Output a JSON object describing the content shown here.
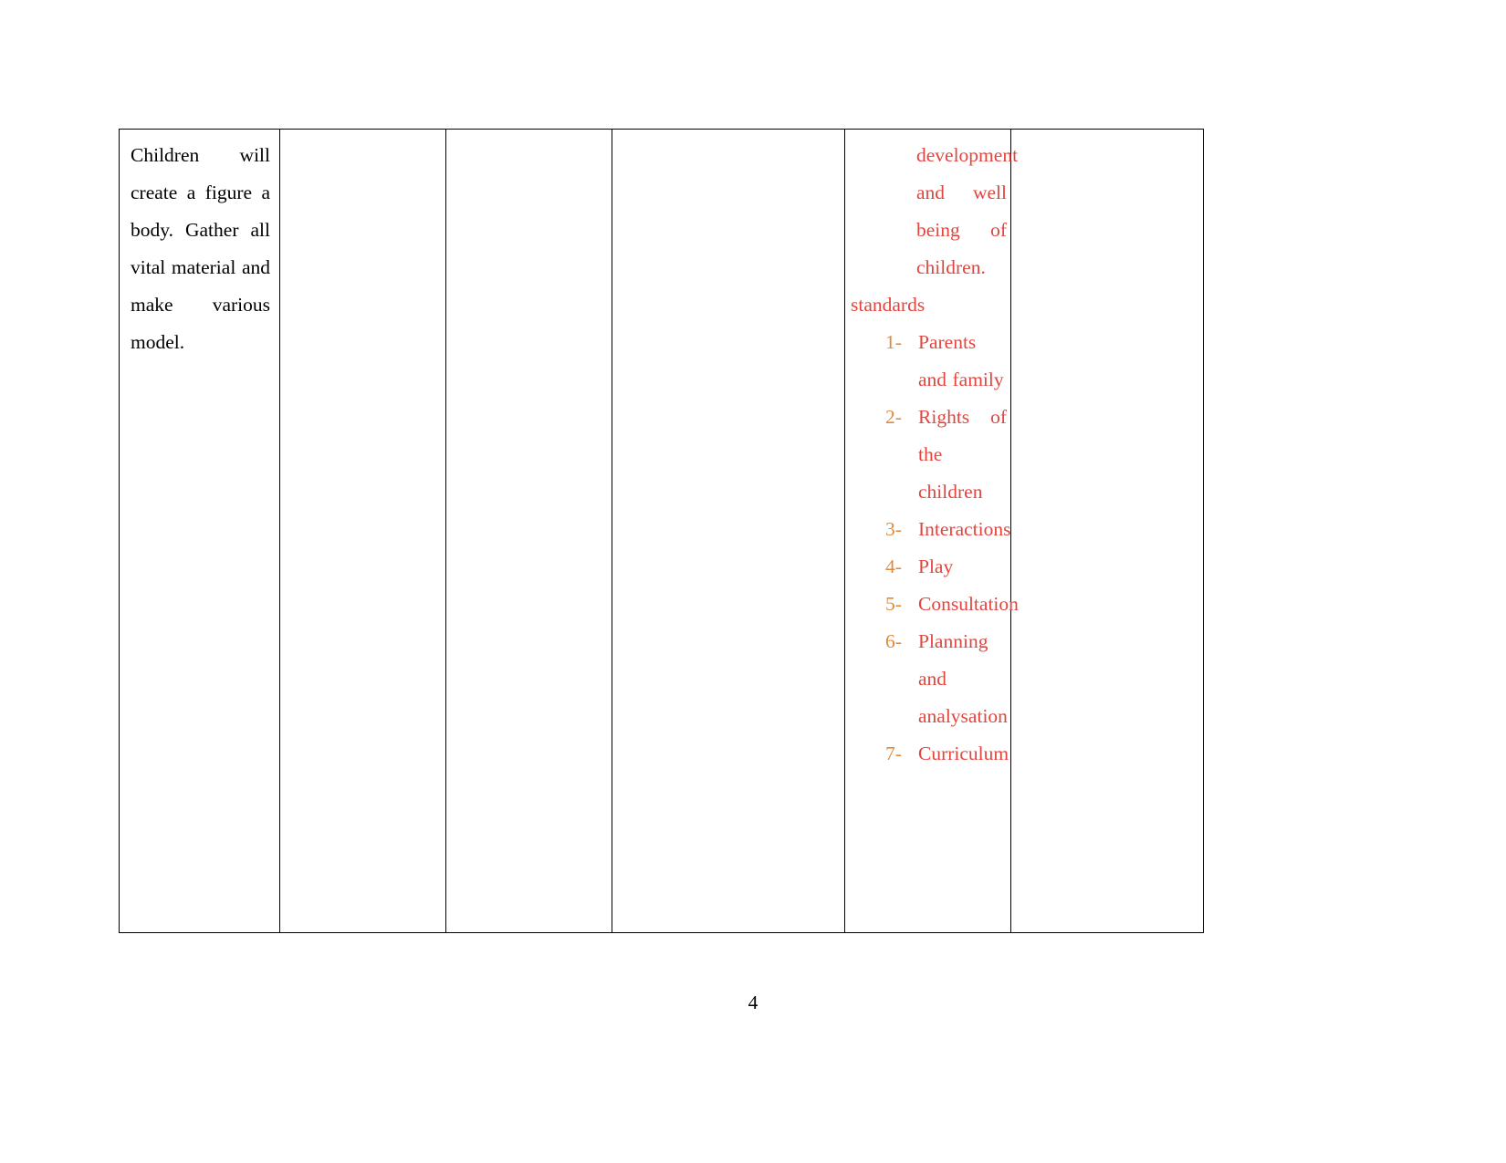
{
  "document": {
    "page_number": "4",
    "colors": {
      "red_text": "#E2453F",
      "list_marker": "#E08A3C",
      "border": "#000000",
      "body_text": "#000000"
    }
  },
  "table": {
    "columns": 6,
    "row": {
      "col1": {
        "text": "Children will create a figure a body. Gather all vital material and make various model."
      },
      "col2": {
        "text": ""
      },
      "col3": {
        "text": ""
      },
      "col4": {
        "text": ""
      },
      "col5": {
        "continuation_text": "development and well being of children.",
        "heading": "standards",
        "list": [
          {
            "marker": "1-",
            "text": "Parents and family"
          },
          {
            "marker": "2-",
            "text": "Rights of the children"
          },
          {
            "marker": "3-",
            "text": "Interactions"
          },
          {
            "marker": "4-",
            "text": "Play"
          },
          {
            "marker": "5-",
            "text": "Consultation"
          },
          {
            "marker": "6-",
            "text": "Planning and analysation"
          },
          {
            "marker": "7-",
            "text": "Curriculum"
          }
        ]
      },
      "col6": {
        "text": ""
      }
    }
  }
}
